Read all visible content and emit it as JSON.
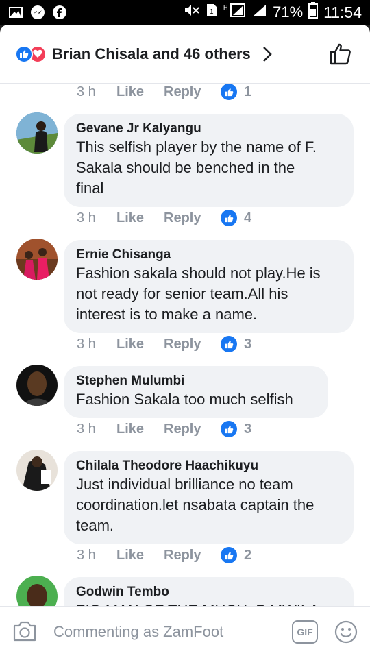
{
  "status_bar": {
    "battery": "71%",
    "time": "11:54"
  },
  "header": {
    "reactors_text": "Brian Chisala and 46 others"
  },
  "top_meta": {
    "time": "3 h",
    "like": "Like",
    "reply": "Reply",
    "count": "1"
  },
  "comments": [
    {
      "name": "Gevane Jr Kalyangu",
      "lines": [
        "This selfish player by the name of F.",
        "Sakala should be benched in the",
        "final"
      ],
      "time": "3 h",
      "like": "Like",
      "reply": "Reply",
      "count": "4"
    },
    {
      "name": "Ernie Chisanga",
      "lines": [
        "Fashion sakala should not play.He is",
        "not ready for senior team.All his",
        "interest is to make a name."
      ],
      "time": "3 h",
      "like": "Like",
      "reply": "Reply",
      "count": "3"
    },
    {
      "name": "Stephen Mulumbi",
      "lines": [
        "Fashion Sakala too much selfish"
      ],
      "time": "3 h",
      "like": "Like",
      "reply": "Reply",
      "count": "3"
    },
    {
      "name": "Chilala Theodore Haachikuyu",
      "lines": [
        "Just individual brilliance no team",
        "coordination.let nsabata captain the",
        "team."
      ],
      "time": "3 h",
      "like": "Like",
      "reply": "Reply",
      "count": "2"
    },
    {
      "name": "Godwin Tembo",
      "lines": [
        "ZIG MAN OF THE MUCH, P MWILA"
      ]
    }
  ],
  "footer": {
    "placeholder": "Commenting as ZamFoot",
    "gif_label": "GIF"
  },
  "colors": {
    "accent": "#1877f2",
    "love": "#f33e58",
    "bubble": "#f0f2f5",
    "meta": "#8d949e"
  }
}
